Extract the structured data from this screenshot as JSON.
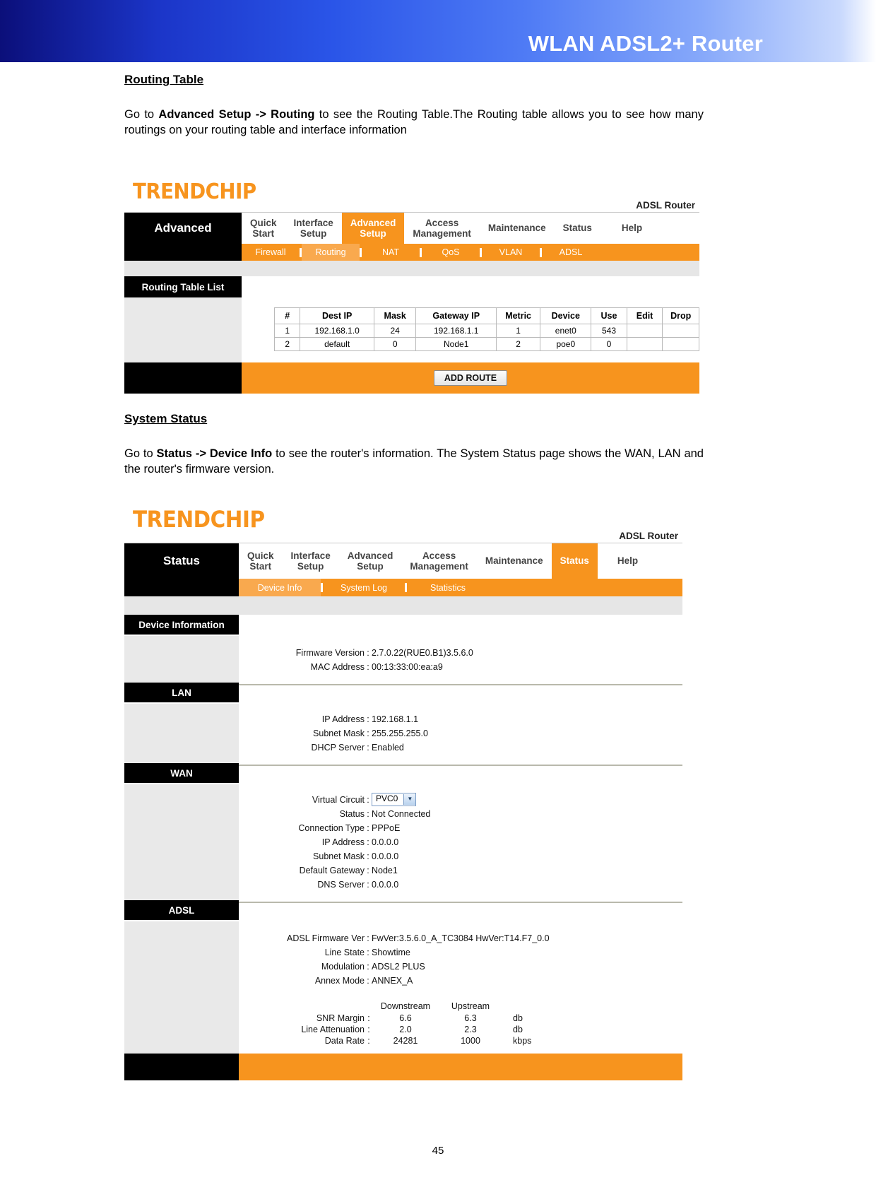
{
  "banner": {
    "title": "WLAN ADSL2+ Router"
  },
  "page_number": "45",
  "sections": [
    {
      "heading": "Routing Table",
      "para_lead": "Go to ",
      "para_bold": "Advanced Setup -> Routing",
      "para_rest": " to see the Routing Table.The Routing table allows you to see how many routings on your routing table and interface information"
    },
    {
      "heading": "System Status",
      "para_lead": "Go to ",
      "para_bold": "Status -> Device Info",
      "para_rest": " to see the router's information. The System Status page shows the WAN, LAN and the router's firmware version."
    }
  ],
  "router_ui": {
    "logo": "TRENDCHIP",
    "corner_label": "ADSL Router",
    "routing_screen": {
      "side_label": "Advanced",
      "tabs": [
        {
          "line1": "Quick",
          "line2": "Start",
          "active": false
        },
        {
          "line1": "Interface",
          "line2": "Setup",
          "active": false
        },
        {
          "line1": "Advanced",
          "line2": "Setup",
          "active": true
        },
        {
          "line1": "Access",
          "line2": "Management",
          "active": false
        },
        {
          "line1": "Maintenance",
          "line2": "",
          "active": false
        },
        {
          "line1": "Status",
          "line2": "",
          "active": false
        },
        {
          "line1": "Help",
          "line2": "",
          "active": false
        }
      ],
      "subnav": [
        {
          "label": "Firewall",
          "active": false
        },
        {
          "label": "Routing",
          "active": true
        },
        {
          "label": "NAT",
          "active": false
        },
        {
          "label": "QoS",
          "active": false
        },
        {
          "label": "VLAN",
          "active": false
        },
        {
          "label": "ADSL",
          "active": false
        }
      ],
      "panel_label": "Routing Table List",
      "table": {
        "headers": [
          "#",
          "Dest IP",
          "Mask",
          "Gateway IP",
          "Metric",
          "Device",
          "Use",
          "Edit",
          "Drop"
        ],
        "rows": [
          [
            "1",
            "192.168.1.0",
            "24",
            "192.168.1.1",
            "1",
            "enet0",
            "543",
            "",
            ""
          ],
          [
            "2",
            "default",
            "0",
            "Node1",
            "2",
            "poe0",
            "0",
            "",
            ""
          ]
        ]
      },
      "add_route_button": "ADD ROUTE"
    },
    "status_screen": {
      "side_label": "Status",
      "tabs": [
        {
          "line1": "Quick",
          "line2": "Start",
          "active": false
        },
        {
          "line1": "Interface",
          "line2": "Setup",
          "active": false
        },
        {
          "line1": "Advanced",
          "line2": "Setup",
          "active": false
        },
        {
          "line1": "Access",
          "line2": "Management",
          "active": false
        },
        {
          "line1": "Maintenance",
          "line2": "",
          "active": false
        },
        {
          "line1": "Status",
          "line2": "",
          "active": true
        },
        {
          "line1": "Help",
          "line2": "",
          "active": false
        }
      ],
      "subnav": [
        {
          "label": "Device Info",
          "active": true
        },
        {
          "label": "System Log",
          "active": false
        },
        {
          "label": "Statistics",
          "active": false
        }
      ],
      "panels": {
        "device_information": {
          "title": "Device Information",
          "rows": [
            {
              "label": "Firmware Version",
              "value": "2.7.0.22(RUE0.B1)3.5.6.0"
            },
            {
              "label": "MAC Address",
              "value": "00:13:33:00:ea:a9"
            }
          ]
        },
        "lan": {
          "title": "LAN",
          "rows": [
            {
              "label": "IP Address",
              "value": "192.168.1.1"
            },
            {
              "label": "Subnet Mask",
              "value": "255.255.255.0"
            },
            {
              "label": "DHCP Server",
              "value": "Enabled"
            }
          ]
        },
        "wan": {
          "title": "WAN",
          "virtual_circuit_label": "Virtual Circuit",
          "virtual_circuit_value": "PVC0",
          "rows": [
            {
              "label": "Status",
              "value": "Not Connected"
            },
            {
              "label": "Connection Type",
              "value": "PPPoE"
            },
            {
              "label": "IP Address",
              "value": "0.0.0.0"
            },
            {
              "label": "Subnet Mask",
              "value": "0.0.0.0"
            },
            {
              "label": "Default Gateway",
              "value": "Node1"
            },
            {
              "label": "DNS Server",
              "value": "0.0.0.0"
            }
          ]
        },
        "adsl": {
          "title": "ADSL",
          "rows": [
            {
              "label": "ADSL Firmware Ver",
              "value": "FwVer:3.5.6.0_A_TC3084 HwVer:T14.F7_0.0"
            },
            {
              "label": "Line State",
              "value": "Showtime"
            },
            {
              "label": "Modulation",
              "value": "ADSL2 PLUS"
            },
            {
              "label": "Annex Mode",
              "value": "ANNEX_A"
            }
          ],
          "stats": {
            "col_headers": [
              "Downstream",
              "Upstream"
            ],
            "rows": [
              {
                "label": "SNR Margin",
                "downstream": "6.6",
                "upstream": "6.3",
                "unit": "db"
              },
              {
                "label": "Line Attenuation",
                "downstream": "2.0",
                "upstream": "2.3",
                "unit": "db"
              },
              {
                "label": "Data Rate",
                "downstream": "24281",
                "upstream": "1000",
                "unit": "kbps"
              }
            ]
          }
        }
      }
    }
  },
  "colors": {
    "brand_orange": "#F7941E",
    "subnav_active": "#F9A94E",
    "banner_blue": "#2a55e8"
  }
}
